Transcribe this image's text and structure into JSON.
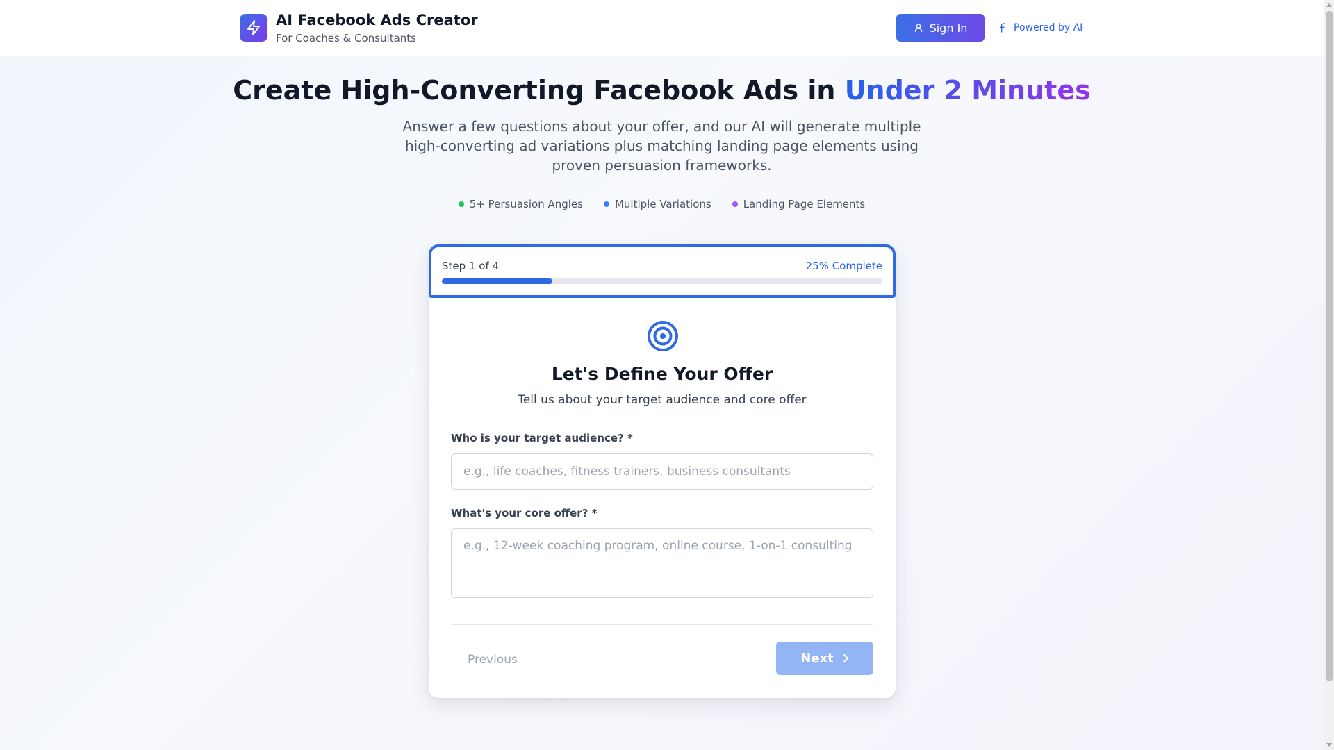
{
  "header": {
    "app_title": "AI Facebook Ads Creator",
    "app_subtitle": "For Coaches & Consultants",
    "logo_icon": "lightning-icon",
    "signin_label": "Sign In",
    "powered_label": "Powered by AI"
  },
  "hero": {
    "title_main": "Create High-Converting Facebook Ads in ",
    "title_highlight": "Under 2 Minutes",
    "description": "Answer a few questions about your offer, and our AI will generate multiple high-converting ad variations plus matching landing page elements using proven persuasion frameworks.",
    "features": [
      {
        "label": "5+ Persuasion Angles",
        "color": "#22c55e"
      },
      {
        "label": "Multiple Variations",
        "color": "#3b82f6"
      },
      {
        "label": "Landing Page Elements",
        "color": "#a855f7"
      }
    ]
  },
  "progress": {
    "step_label": "Step 1 of 4",
    "percent_label": "25% Complete",
    "fraction": 0.25
  },
  "step": {
    "icon": "target-icon",
    "title": "Let's Define Your Offer",
    "subtitle": "Tell us about your target audience and core offer",
    "audience_label": "Who is your target audience? *",
    "audience_placeholder": "e.g., life coaches, fitness trainers, business consultants",
    "audience_value": "",
    "offer_label": "What's your core offer? *",
    "offer_placeholder": "e.g., 12-week coaching program, online course, 1-on-1 consulting",
    "offer_value": "",
    "prev_label": "Previous",
    "next_label": "Next"
  },
  "colors": {
    "accent_blue": "#2f6ae6",
    "accent_purple": "#7c3aed",
    "next_disabled": "#93b4f5"
  }
}
